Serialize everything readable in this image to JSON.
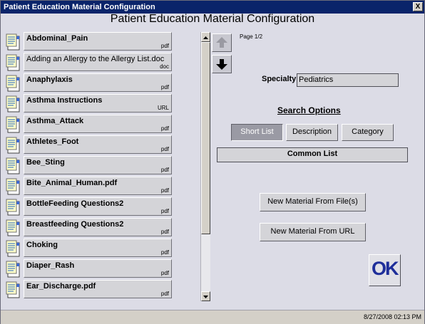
{
  "window": {
    "title": "Patient Education Material Configuration",
    "close_symbol": "X"
  },
  "heading": "Patient Education Material Configuration",
  "materials": [
    {
      "name": "Abdominal_Pain",
      "type": "pdf",
      "bold": true
    },
    {
      "name": "Adding an Allergy to the Allergy List.doc",
      "type": "doc",
      "bold": false
    },
    {
      "name": "Anaphylaxis",
      "type": "pdf",
      "bold": true
    },
    {
      "name": "Asthma Instructions",
      "type": "URL",
      "bold": true
    },
    {
      "name": "Asthma_Attack",
      "type": "pdf",
      "bold": true
    },
    {
      "name": "Athletes_Foot",
      "type": "pdf",
      "bold": true
    },
    {
      "name": "Bee_Sting",
      "type": "pdf",
      "bold": true
    },
    {
      "name": "Bite_Animal_Human.pdf",
      "type": "pdf",
      "bold": true
    },
    {
      "name": "BottleFeeding Questions2",
      "type": "pdf",
      "bold": true
    },
    {
      "name": "Breastfeeding Questions2",
      "type": "pdf",
      "bold": true
    },
    {
      "name": "Choking",
      "type": "pdf",
      "bold": true
    },
    {
      "name": "Diaper_Rash",
      "type": "pdf",
      "bold": true
    },
    {
      "name": "Ear_Discharge.pdf",
      "type": "pdf",
      "bold": true
    }
  ],
  "icons": {
    "document": "document-icon",
    "up": "arrow-up-icon",
    "down": "arrow-down-icon"
  },
  "pager": {
    "label": "Page 1/2"
  },
  "specialty": {
    "label": "Specialty:",
    "value": "Pediatrics"
  },
  "search": {
    "heading": "Search Options",
    "options": [
      "Short List",
      "Description",
      "Category"
    ],
    "active": "Short List",
    "list_label": "Common List"
  },
  "actions": {
    "new_from_file": "New Material From File(s)",
    "new_from_url": "New Material From URL"
  },
  "ok_label": "OK",
  "status": {
    "datetime": "8/27/2008  02:13 PM"
  },
  "colors": {
    "titlebar": "#0a246a",
    "background": "#dcdce6",
    "ok_text": "#1e2e9a",
    "active_option": "#9a9aa4"
  }
}
